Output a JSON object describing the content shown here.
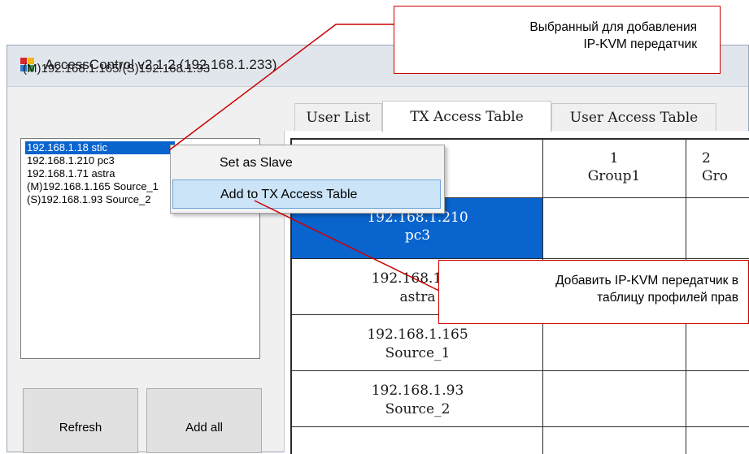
{
  "window": {
    "title": "AccessControl v2.1.2 (192.168.1.233)",
    "connection": "(M)192.168.1.165/(S)192.168.1.93"
  },
  "sources": [
    "192.168.1.18 stic",
    "192.168.1.210 pc3",
    "192.168.1.71 astra",
    "(M)192.168.1.165 Source_1",
    "(S)192.168.1.93 Source_2"
  ],
  "buttons": {
    "refresh": "Refresh",
    "add_all": "Add all"
  },
  "tabs": [
    "User List",
    "TX Access Table",
    "User Access Table"
  ],
  "grid": {
    "columns": [
      {
        "num": "1",
        "name": "Group1"
      },
      {
        "num": "2",
        "name": "Gro"
      }
    ],
    "rows": [
      {
        "ip": "192.168.1.210",
        "name": "pc3"
      },
      {
        "ip": "192.168.1.71",
        "name": "astra"
      },
      {
        "ip": "192.168.1.165",
        "name": "Source_1"
      },
      {
        "ip": "192.168.1.93",
        "name": "Source_2"
      }
    ]
  },
  "context_menu": [
    "Set as Slave",
    "Add to TX Access Table"
  ],
  "callouts": {
    "top": [
      "Выбранный для добавления",
      "IP-KVM передатчик"
    ],
    "bottom": [
      "Добавить IP-KVM передатчик в",
      "таблицу профилей прав"
    ]
  },
  "colors": {
    "selection": "#0a64ce",
    "callout_border": "#cc0000",
    "menu_hover": "#cce4f7"
  }
}
